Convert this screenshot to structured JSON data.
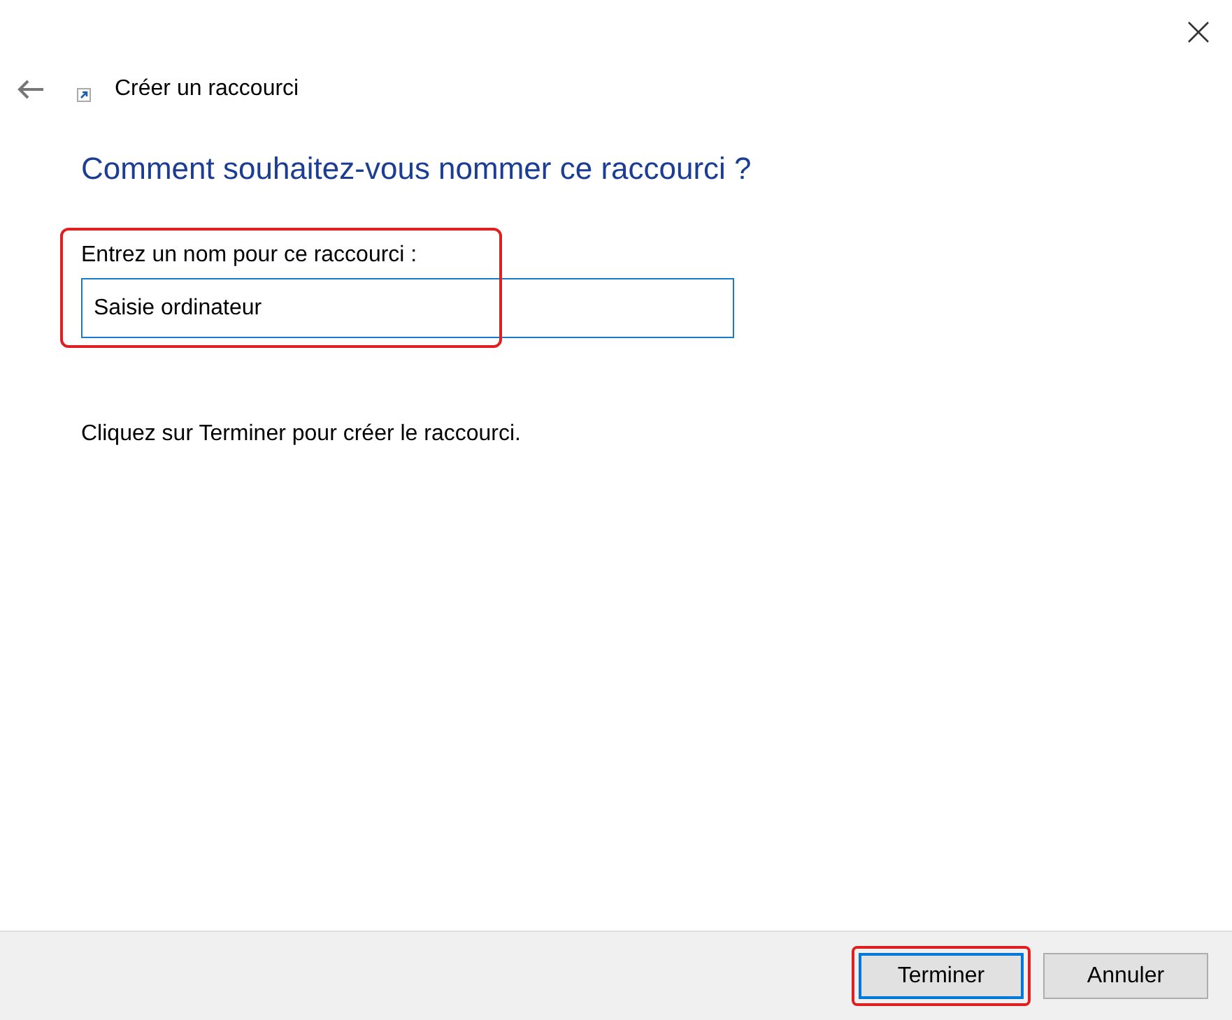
{
  "window": {
    "title": "Créer un raccourci"
  },
  "heading": "Comment souhaitez-vous nommer ce raccourci ?",
  "name_field": {
    "label": "Entrez un nom pour ce raccourci :",
    "value": "Saisie ordinateur"
  },
  "instruction": "Cliquez sur Terminer pour créer le raccourci.",
  "buttons": [
    {
      "label": "Terminer",
      "selected": true
    },
    {
      "label": "Annuler",
      "selected": false
    }
  ]
}
